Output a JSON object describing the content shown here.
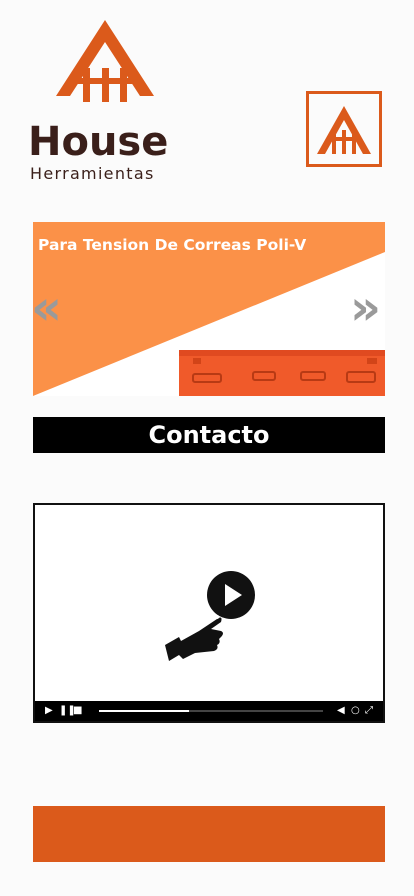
{
  "brand": {
    "name": "House",
    "subtitle": "Herramientas"
  },
  "colors": {
    "brand_orange": "#db5a1b",
    "slide_orange": "#fb9148",
    "brand_brown": "#3a1f1a"
  },
  "menu": {
    "icon": "house-logo-icon"
  },
  "slider": {
    "title": "Para Tension De Correas Poli-V",
    "prev": "«",
    "next": "»"
  },
  "contact": {
    "label": "Contacto"
  },
  "video": {
    "icons": [
      "play-icon",
      "pause-icon",
      "stop-icon",
      "volume-icon",
      "settings-icon",
      "fullscreen-icon"
    ],
    "progress": 0.4
  }
}
